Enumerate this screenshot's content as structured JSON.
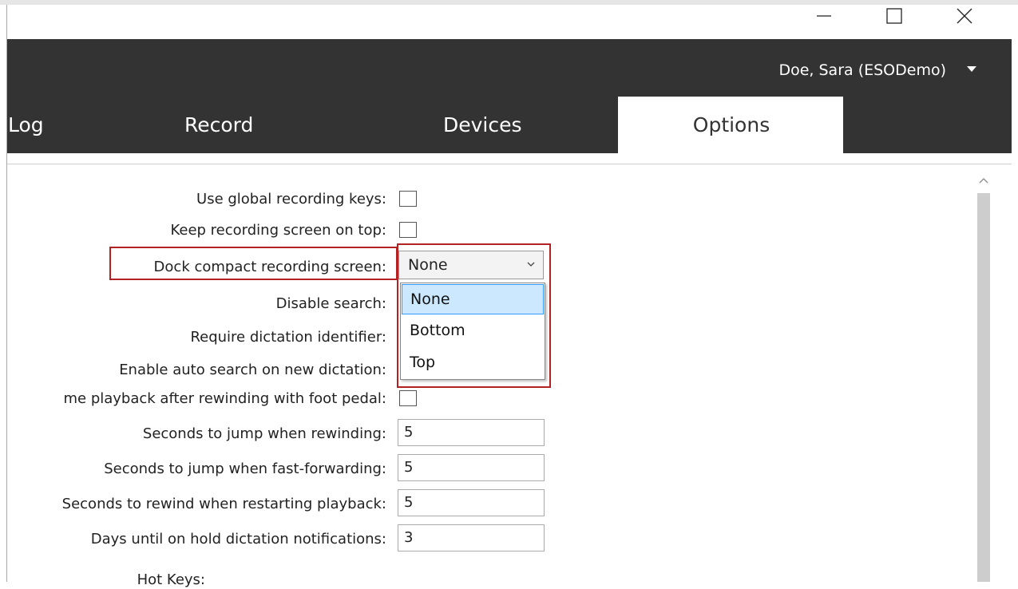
{
  "window": {
    "minimize_icon": "minimize-icon",
    "maximize_icon": "maximize-icon",
    "close_icon": "close-icon"
  },
  "header": {
    "user_name": "Doe, Sara (ESODemo)",
    "user_menu_icon": "caret-down-icon",
    "background": "#333333"
  },
  "tabs": [
    {
      "label": "Log",
      "selected": false
    },
    {
      "label": "Record",
      "selected": false
    },
    {
      "label": "Devices",
      "selected": false
    },
    {
      "label": "Options",
      "selected": true
    }
  ],
  "options": {
    "use_global_keys": {
      "label": "Use global recording keys:",
      "checked": false
    },
    "keep_on_top": {
      "label": "Keep recording screen on top:",
      "checked": false
    },
    "dock_compact": {
      "label": "Dock compact recording screen:",
      "value": "None",
      "options": [
        "None",
        "Bottom",
        "Top"
      ],
      "highlighted": "None"
    },
    "disable_search": {
      "label": "Disable search:"
    },
    "require_identifier": {
      "label": "Require dictation identifier:"
    },
    "auto_search": {
      "label": "Enable auto search on new dictation:"
    },
    "resume_playback": {
      "label": "me playback after rewinding with foot pedal:",
      "checked": false
    },
    "seconds_rewind": {
      "label": "Seconds to jump when rewinding:",
      "value": "5"
    },
    "seconds_ff": {
      "label": "Seconds to jump when fast-forwarding:",
      "value": "5"
    },
    "seconds_restart": {
      "label": "Seconds to rewind when restarting playback:",
      "value": "5"
    },
    "days_on_hold": {
      "label": "Days until on hold dictation notifications:",
      "value": "3"
    },
    "hot_keys": {
      "label": "Hot Keys:"
    }
  },
  "colors": {
    "highlight_outline": "#b22222",
    "selected_item_bg": "#cce8ff",
    "selected_item_border": "#3399ff"
  }
}
